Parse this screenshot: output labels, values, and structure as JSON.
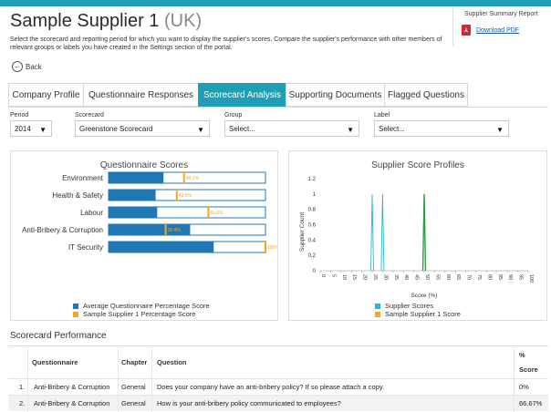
{
  "header": {
    "title": "Sample Supplier 1",
    "country": "(UK)",
    "intro": "Select the scorecard and reporting period for which you want to display the supplier's scores. Compare the supplier's performance with other members of relevant groups or labels you have created in the Settings section of the portal."
  },
  "summary_report": {
    "title": "Supplier Summary Report",
    "download_label": "Download PDF",
    "icon": "pdf-icon"
  },
  "back": {
    "label": "Back",
    "icon": "back-arrow-icon"
  },
  "tabs": [
    {
      "label": "Company Profile"
    },
    {
      "label": "Questionnaire Responses"
    },
    {
      "label": "Scorecard Analysis",
      "active": true
    },
    {
      "label": "Supporting Documents"
    },
    {
      "label": "Flagged Questions"
    }
  ],
  "filters": {
    "period": {
      "label": "Period",
      "value": "2014"
    },
    "scorecard": {
      "label": "Scorecard",
      "value": "Greenstone Scorecard"
    },
    "group": {
      "label": "Group",
      "value": "Select..."
    },
    "label": {
      "label": "Label",
      "value": "Select..."
    }
  },
  "colors": {
    "accent": "#1f9fb5",
    "average_bar": "#1f78b4",
    "supplier_marker": "#f5a623",
    "supplier_scores_line": "#29b6d6",
    "supplier1_line": "#2e9e4a"
  },
  "chart_data": [
    {
      "type": "bar",
      "title": "Questionnaire Scores",
      "categories": [
        "Environment",
        "Health & Safety",
        "Labour",
        "Anti-Bribery & Corruption",
        "IT Security"
      ],
      "series": [
        {
          "name": "Average Questionnaire Percentage Score",
          "values": [
            35,
            30,
            31,
            52,
            67
          ]
        },
        {
          "name": "Sample Supplier 1 Percentage Score",
          "values": [
            48.1,
            43.5,
            63.6,
            36.4,
            100
          ]
        }
      ],
      "data_labels": [
        "48.1%",
        "43.5%",
        "63.6%",
        "36.4%",
        "100%"
      ],
      "xlim": [
        0,
        100
      ]
    },
    {
      "type": "line",
      "title": "Supplier Score Profiles",
      "xlabel": "Score (%)",
      "ylabel": "Supplier Count",
      "x_ticks": [
        0,
        5,
        10,
        15,
        20,
        25,
        30,
        35,
        40,
        45,
        50,
        55,
        60,
        65,
        70,
        75,
        80,
        85,
        90,
        95,
        100
      ],
      "y_ticks": [
        "0",
        "0.2",
        "0.4",
        "0.6",
        "0.8",
        "1",
        "1.2"
      ],
      "ylim": [
        0,
        1.2
      ],
      "xlim": [
        0,
        100
      ],
      "series": [
        {
          "name": "Supplier Scores",
          "spikes": [
            {
              "x": 25,
              "y": 1
            },
            {
              "x": 30,
              "y": 1
            },
            {
              "x": 50,
              "y": 1
            }
          ]
        },
        {
          "name": "Sample Supplier 1 Score",
          "spikes": [
            {
              "x": 50,
              "y": 1
            }
          ]
        }
      ]
    }
  ],
  "scorecard_performance": {
    "title": "Scorecard Performance",
    "columns": [
      "Questionnaire",
      "Chapter",
      "Question",
      "%",
      "Score"
    ],
    "rows": [
      {
        "num": "1.",
        "questionnaire": "Anti-Bribery & Corruption",
        "chapter": "General",
        "question": "Does your company have an anti-bribery policy? If so please attach a copy.",
        "score": "0%"
      },
      {
        "num": "2.",
        "questionnaire": "Anti-Bribery & Corruption",
        "chapter": "General",
        "question": "How is your anti-bribery policy communicated to employees?",
        "score": "66.67%"
      }
    ]
  }
}
